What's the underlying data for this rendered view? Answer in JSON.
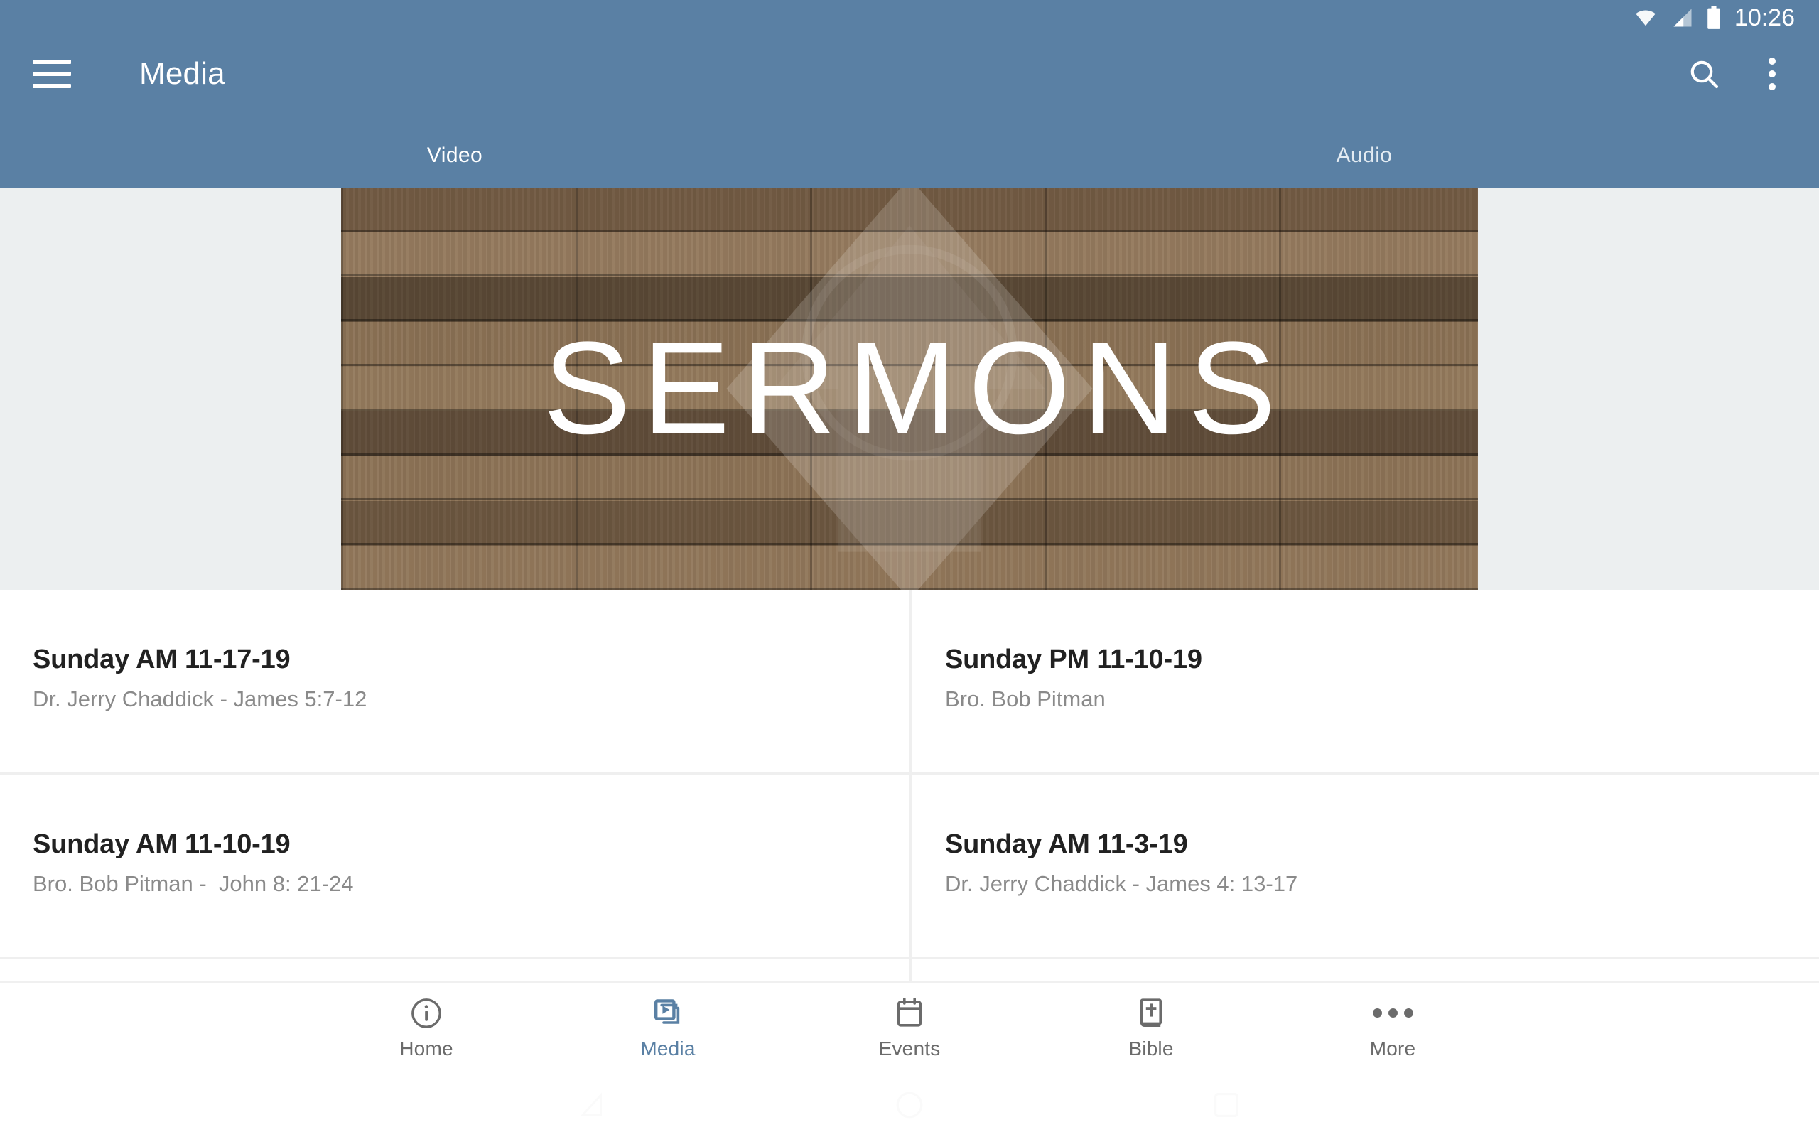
{
  "status_bar": {
    "time": "10:26",
    "icons": [
      "wifi-icon",
      "cellular-signal-icon",
      "battery-icon"
    ]
  },
  "app_bar": {
    "menu_icon": "hamburger-menu-icon",
    "title": "Media",
    "search_icon": "search-icon",
    "overflow_icon": "overflow-menu-icon"
  },
  "tabs": {
    "items": [
      {
        "label": "Video",
        "active": true
      },
      {
        "label": "Audio",
        "active": false
      }
    ]
  },
  "banner": {
    "title": "SERMONS",
    "background": "wood-plank-texture",
    "logo": "diamond-arrow-watermark-logo",
    "backdrop_color": "#eceff0"
  },
  "list": {
    "rows": [
      [
        {
          "title": "Sunday AM 11-17-19",
          "subtitle": "Dr. Jerry Chaddick - James 5:7-12"
        },
        {
          "title": "Sunday PM 11-10-19",
          "subtitle": "Bro. Bob Pitman"
        }
      ],
      [
        {
          "title": "Sunday AM 11-10-19",
          "subtitle": "Bro. Bob Pitman -  John 8: 21-24"
        },
        {
          "title": "Sunday AM 11-3-19",
          "subtitle": "Dr. Jerry Chaddick - James 4: 13-17"
        }
      ]
    ]
  },
  "bottom_nav": {
    "items": [
      {
        "label": "Home",
        "icon": "info-circle-icon",
        "active": false
      },
      {
        "label": "Media",
        "icon": "video-stack-icon",
        "active": true
      },
      {
        "label": "Events",
        "icon": "calendar-icon",
        "active": false
      },
      {
        "label": "Bible",
        "icon": "bible-book-icon",
        "active": false
      },
      {
        "label": "More",
        "icon": "more-dots-icon",
        "active": false
      }
    ],
    "active_color": "#5a80a4",
    "inactive_color": "#6b6b6b"
  },
  "system_nav": {
    "back": "back-triangle-icon",
    "home": "home-circle-icon",
    "recents": "recents-square-icon"
  },
  "theme": {
    "primary": "#5a80a4",
    "divider": "#efefef",
    "title_text": "#212121",
    "subtitle_text": "#8a8a8a"
  }
}
